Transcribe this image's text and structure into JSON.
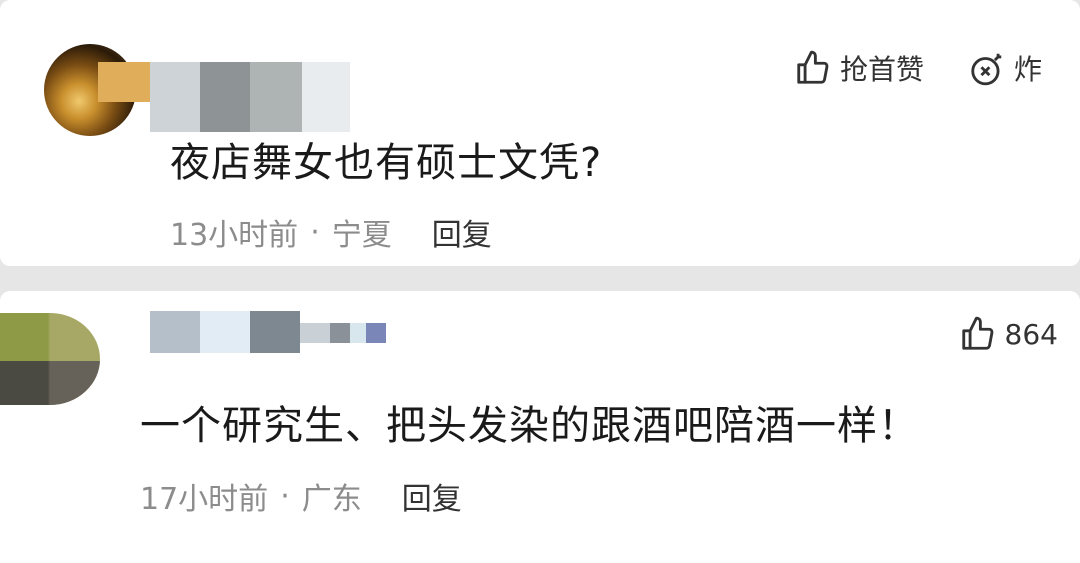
{
  "comments": [
    {
      "text": "夜店舞女也有硕士文凭?",
      "time": "13小时前",
      "separator": "·",
      "location": "宁夏",
      "reply_label": "回复",
      "like_label": "抢首赞",
      "bomb_label": "炸"
    },
    {
      "text": "一个研究生、把头发染的跟酒吧陪酒一样！",
      "time": "17小时前",
      "separator": "·",
      "location": "广东",
      "reply_label": "回复",
      "like_count": "864"
    }
  ],
  "colors": {
    "background": "#e6e6e6",
    "card": "#ffffff",
    "text": "#1a1a1a",
    "meta": "#8c8c8c"
  },
  "icons": {
    "like": "thumbs-up-icon",
    "bomb": "bomb-icon"
  }
}
